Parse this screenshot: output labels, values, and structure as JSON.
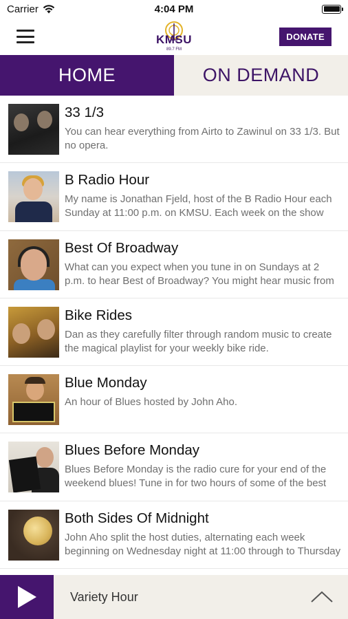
{
  "status_bar": {
    "carrier": "Carrier",
    "time": "4:04 PM"
  },
  "header": {
    "logo_text": "KMSU",
    "logo_sub": "89.7 FM",
    "donate_label": "DONATE"
  },
  "tabs": [
    {
      "label": "HOME",
      "active": true
    },
    {
      "label": "ON DEMAND",
      "active": false
    }
  ],
  "shows": [
    {
      "title": "33 1/3",
      "description": "You can hear everything from Airto to Zawinul on 33 1/3. But no opera."
    },
    {
      "title": "B Radio Hour",
      "description": "My name is Jonathan Fjeld, host of the B Radio Hour each Sunday at 11:00 p.m. on KMSU. Each week on the show"
    },
    {
      "title": "Best Of Broadway",
      "description": "What can you expect when you tune in on Sundays at 2 p.m. to hear Best of Broadway? You might hear music from"
    },
    {
      "title": "Bike Rides",
      "description": "Dan as they carefully filter through random music to create the magical playlist for your weekly bike ride."
    },
    {
      "title": "Blue Monday",
      "description": "An hour of Blues hosted by John Aho."
    },
    {
      "title": "Blues Before Monday",
      "description": "Blues Before Monday is the radio cure for your end of the weekend blues! Tune in for two hours of some of the best"
    },
    {
      "title": "Both Sides Of Midnight",
      "description": "John Aho split the host duties, alternating each week beginning on Wednesday night at 11:00 through to Thursday"
    }
  ],
  "player": {
    "now_playing": "Variety Hour"
  },
  "colors": {
    "brand_purple": "#45156e",
    "tab_inactive_bg": "#f2efe9",
    "description_gray": "#6f6f6f"
  }
}
